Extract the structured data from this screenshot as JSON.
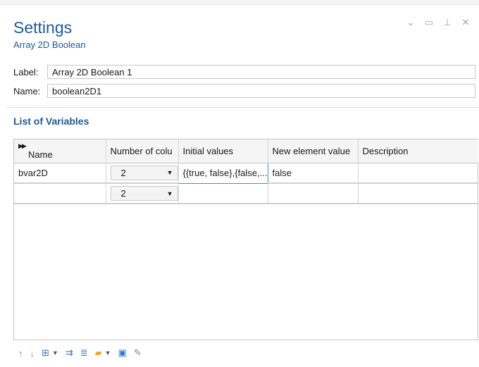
{
  "window": {
    "title": "Settings",
    "subtitle": "Array 2D Boolean",
    "controls": [
      {
        "name": "chevron-down-icon",
        "glyph": "⌄"
      },
      {
        "name": "maximize-icon",
        "glyph": "▭"
      },
      {
        "name": "pin-icon",
        "glyph": "⊥"
      },
      {
        "name": "close-icon",
        "glyph": "✕"
      }
    ]
  },
  "fields": {
    "label": {
      "caption": "Label:",
      "value": "Array 2D Boolean 1"
    },
    "name": {
      "caption": "Name:",
      "value": "boolean2D1"
    }
  },
  "section": {
    "title": "List of Variables"
  },
  "table": {
    "headers": [
      "Name",
      "Number of colu",
      "Initial values",
      "New element value",
      "Description"
    ],
    "rows": [
      {
        "name": "bvar2D",
        "columns": "2",
        "initial": "{{true, false},{false,...",
        "new_value": "false",
        "description": ""
      },
      {
        "name": "",
        "columns": "2",
        "initial": "",
        "new_value": "",
        "description": ""
      }
    ]
  },
  "toolbar": [
    {
      "name": "move-up-icon",
      "glyph": "↑"
    },
    {
      "name": "move-down-icon",
      "glyph": "↓"
    },
    {
      "name": "add-row-icon",
      "glyph": "⊞"
    },
    {
      "name": "dropdown-arrow-icon",
      "glyph": "▼"
    },
    {
      "name": "insert-rows-icon",
      "glyph": "⇉"
    },
    {
      "name": "clear-table-icon",
      "glyph": "≣"
    },
    {
      "name": "open-folder-icon",
      "glyph": "▰"
    },
    {
      "name": "dropdown-arrow-icon",
      "glyph": "▼"
    },
    {
      "name": "save-icon",
      "glyph": "▣"
    },
    {
      "name": "edit-icon",
      "glyph": "✎"
    }
  ],
  "colors": {
    "accent": "#1e5a96",
    "border": "#c4c4c4",
    "focus": "#3c8bd9"
  }
}
